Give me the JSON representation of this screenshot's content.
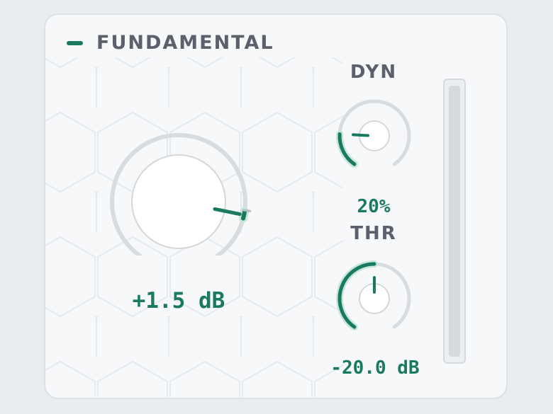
{
  "module": {
    "title": "FUNDAMENTAL",
    "accent_color": "#1a7a60",
    "icon": "accent-dash-icon"
  },
  "main_knob": {
    "label": "",
    "value_text": "+1.5 dB",
    "position": 0.85
  },
  "dyn": {
    "label": "DYN",
    "value_text": "20%",
    "position": 0.2
  },
  "thr": {
    "label": "THR",
    "value_text": "-20.0 dB",
    "position": 0.5
  },
  "level_meter": {
    "level": 0
  }
}
